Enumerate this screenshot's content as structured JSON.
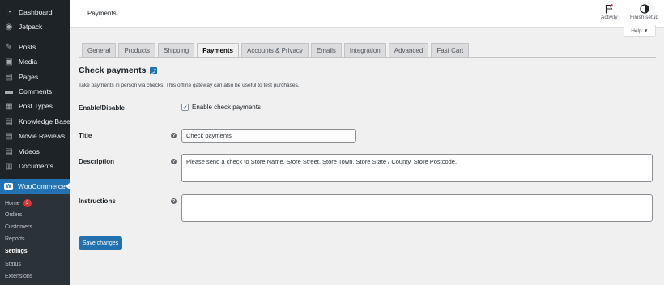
{
  "sidebar": {
    "items": [
      {
        "label": "Dashboard",
        "icon": "dashboard-icon",
        "glyph": "◔"
      },
      {
        "label": "Jetpack",
        "icon": "jetpack-icon",
        "glyph": "◉"
      },
      {
        "label": "Posts",
        "icon": "pin-icon",
        "glyph": "✎"
      },
      {
        "label": "Media",
        "icon": "media-icon",
        "glyph": "▣"
      },
      {
        "label": "Pages",
        "icon": "pages-icon",
        "glyph": "▤"
      },
      {
        "label": "Comments",
        "icon": "comments-icon",
        "glyph": "▬"
      },
      {
        "label": "Post Types",
        "icon": "post-types-icon",
        "glyph": "▦"
      },
      {
        "label": "Knowledge Base",
        "icon": "knowledge-base-icon",
        "glyph": "▤"
      },
      {
        "label": "Movie Reviews",
        "icon": "movie-reviews-icon",
        "glyph": "▤"
      },
      {
        "label": "Videos",
        "icon": "videos-icon",
        "glyph": "▤"
      },
      {
        "label": "Documents",
        "icon": "documents-icon",
        "glyph": "▥"
      },
      {
        "label": "WooCommerce",
        "icon": "woocommerce-icon",
        "glyph": "W"
      }
    ],
    "submenu": [
      {
        "label": "Home",
        "badge": "3"
      },
      {
        "label": "Orders"
      },
      {
        "label": "Customers"
      },
      {
        "label": "Reports"
      },
      {
        "label": "Settings"
      },
      {
        "label": "Status"
      },
      {
        "label": "Extensions"
      }
    ]
  },
  "header": {
    "title": "Payments",
    "activity_label": "Activity",
    "finish_setup_label": "Finish setup",
    "help_label": "Help ▼"
  },
  "tabs": [
    "General",
    "Products",
    "Shipping",
    "Payments",
    "Accounts & Privacy",
    "Emails",
    "Integration",
    "Advanced",
    "Fast Cart"
  ],
  "active_tab": "Payments",
  "content": {
    "section_title": "Check payments",
    "section_desc": "Take payments in person via checks. This offline gateway can also be useful to test purchases.",
    "enable_label": "Enable/Disable",
    "enable_checkbox_label": "Enable check payments",
    "enable_checked": true,
    "title_label": "Title",
    "title_value": "Check payments",
    "description_label": "Description",
    "description_value": "Please send a check to Store Name, Store Street, Store Town, Store State / County, Store Postcode.",
    "instructions_label": "Instructions",
    "instructions_value": "",
    "save_label": "Save changes"
  },
  "colors": {
    "accent": "#2271b1",
    "sidebar_bg": "#1d2327",
    "badge": "#d63638"
  }
}
